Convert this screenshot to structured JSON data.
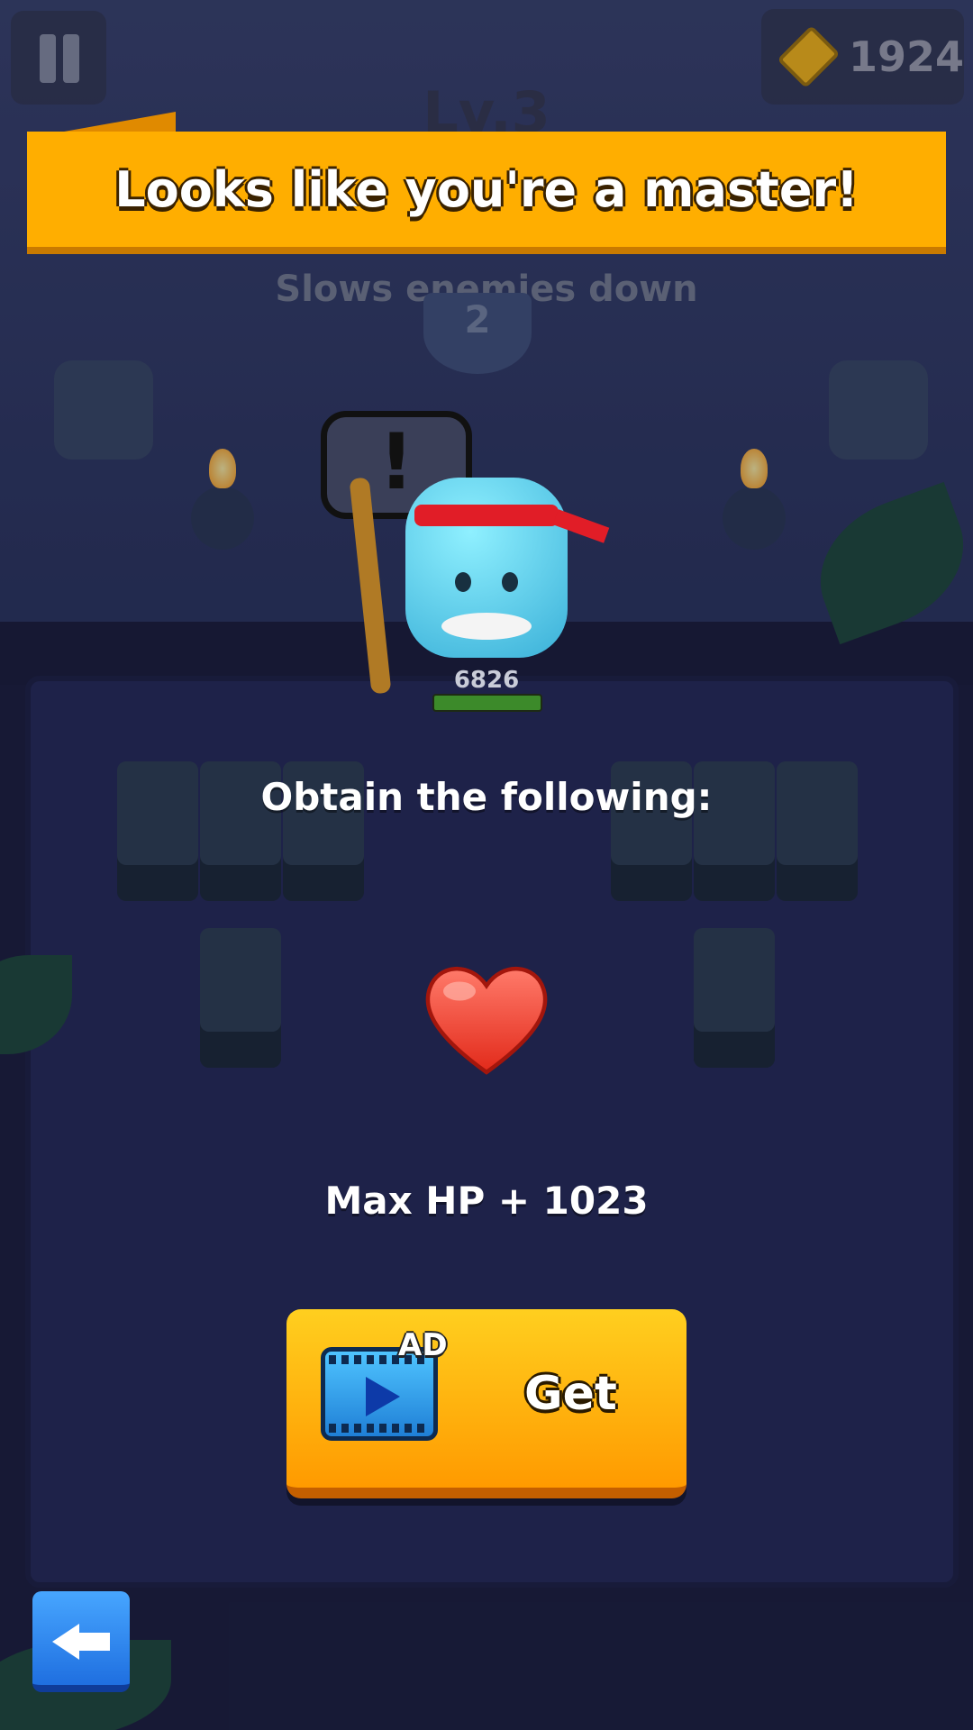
{
  "hud": {
    "currency_value": "1924",
    "currency_icon": "gem-coin-icon",
    "pause_icon": "pause-icon"
  },
  "level_label": "Lv.3",
  "banner": {
    "text": "Looks like you're a master!",
    "color": "#ffae00"
  },
  "skill_hint": "Slows enemies down",
  "skill_badge_number": "2",
  "alert_symbol": "!",
  "hero": {
    "hp_value": "6826"
  },
  "reward": {
    "heading": "Obtain the following:",
    "item_icon": "heart-icon",
    "description": "Max HP + 1023"
  },
  "get_button": {
    "ad_badge": "AD",
    "label": "Get",
    "icon": "video-ad-icon"
  },
  "back_button": {
    "icon": "back-arrow-icon"
  },
  "colors": {
    "accent": "#ffae00",
    "button": "#ff9a00",
    "back": "#2f86f0"
  }
}
